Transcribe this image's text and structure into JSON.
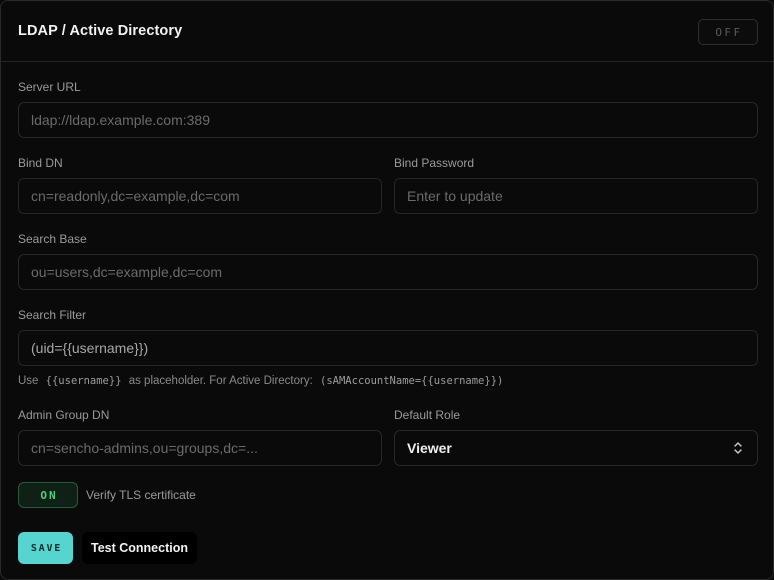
{
  "header": {
    "title": "LDAP / Active Directory",
    "enabled_toggle": "OFF"
  },
  "fields": {
    "server_url": {
      "label": "Server URL",
      "placeholder": "ldap://ldap.example.com:389",
      "value": ""
    },
    "bind_dn": {
      "label": "Bind DN",
      "placeholder": "cn=readonly,dc=example,dc=com",
      "value": ""
    },
    "bind_password": {
      "label": "Bind Password",
      "placeholder": "Enter to update",
      "value": ""
    },
    "search_base": {
      "label": "Search Base",
      "placeholder": "ou=users,dc=example,dc=com",
      "value": ""
    },
    "search_filter": {
      "label": "Search Filter",
      "value": "(uid={{username}})"
    },
    "help": {
      "prefix": "Use",
      "code1": "{{username}}",
      "middle": "as placeholder. For Active Directory:",
      "code2": "(sAMAccountName={{username}})"
    },
    "admin_group_dn": {
      "label": "Admin Group DN",
      "placeholder": "cn=sencho-admins,ou=groups,dc=...",
      "value": ""
    },
    "default_role": {
      "label": "Default Role",
      "selected": "Viewer"
    },
    "verify_tls": {
      "toggle": "ON",
      "label": "Verify TLS certificate"
    }
  },
  "actions": {
    "save_label": "SAVE",
    "test_label": "Test Connection"
  },
  "colors": {
    "accent": "#56d4cf",
    "on_green": "#4ad17e",
    "background": "#0a0a0a"
  }
}
